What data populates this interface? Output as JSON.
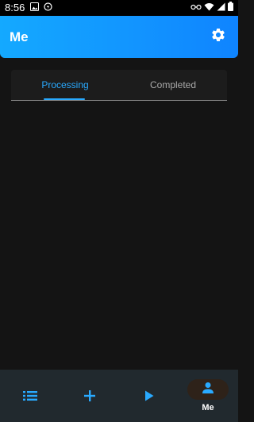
{
  "status_bar": {
    "time": "8:56",
    "left_icons": [
      "image-icon",
      "data-saver-icon"
    ],
    "right_icons": [
      "vpn-key-icon",
      "wifi-icon",
      "signal-icon",
      "battery-icon"
    ]
  },
  "app_bar": {
    "title": "Me",
    "settings_icon": "gear-icon"
  },
  "tabs": [
    {
      "label": "Processing",
      "selected": true
    },
    {
      "label": "Completed",
      "selected": false
    }
  ],
  "bottom_nav": {
    "items": [
      {
        "icon": "list-icon",
        "label": ""
      },
      {
        "icon": "plus-icon",
        "label": ""
      },
      {
        "icon": "play-icon",
        "label": ""
      },
      {
        "icon": "person-icon",
        "label": "Me",
        "selected": true
      }
    ]
  },
  "colors": {
    "accent": "#29aaff",
    "app_bar_gradient": [
      "#14a9ff",
      "#0f84ff"
    ],
    "background": "#141414",
    "nav_background": "#21292e",
    "selected_pill": "#2e2219",
    "inactive_tab_text": "#a9a9a9"
  }
}
